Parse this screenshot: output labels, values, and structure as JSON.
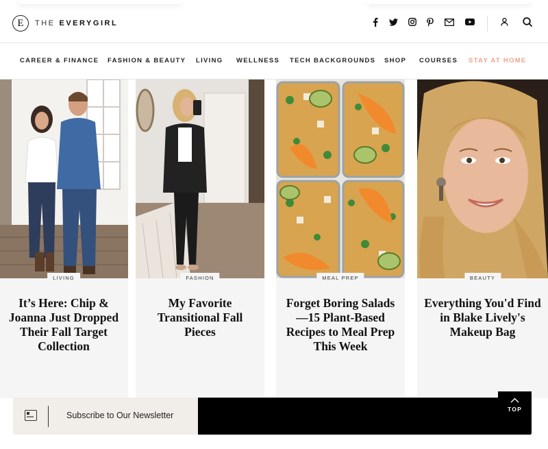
{
  "header": {
    "logo_mark": "E",
    "logo_the": "THE",
    "logo_name": "EVERYGIRL",
    "social_icons": [
      "facebook-icon",
      "twitter-icon",
      "instagram-icon",
      "pinterest-icon",
      "email-icon",
      "youtube-icon"
    ],
    "account_icon": "user-icon",
    "search_icon": "search-icon"
  },
  "nav": {
    "items": [
      "CAREER & FINANCE",
      "FASHION & BEAUTY",
      "LIVING",
      "WELLNESS",
      "TECH BACKGROUNDS",
      "SHOP",
      "COURSES",
      "STAY AT HOME"
    ],
    "accent_color": "#f0a28c"
  },
  "cards": [
    {
      "tag": "LIVING",
      "title": "It’s Here: Chip & Joanna Just Dropped Their Fall Target Collection"
    },
    {
      "tag": "FASHION",
      "title": "My Favorite Transitional Fall Pieces"
    },
    {
      "tag": "MEAL PREP",
      "title": "Forget Boring Salads—15 Plant-Based Recipes to Meal Prep This Week"
    },
    {
      "tag": "BEAUTY",
      "title": "Everything You'd Find in Blake Lively's Makeup Bag"
    }
  ],
  "newsletter": {
    "text": "Subscribe to Our Newsletter",
    "icon": "newsletter-icon"
  },
  "top_button": {
    "label": "TOP",
    "icon": "chevron-up-icon"
  }
}
